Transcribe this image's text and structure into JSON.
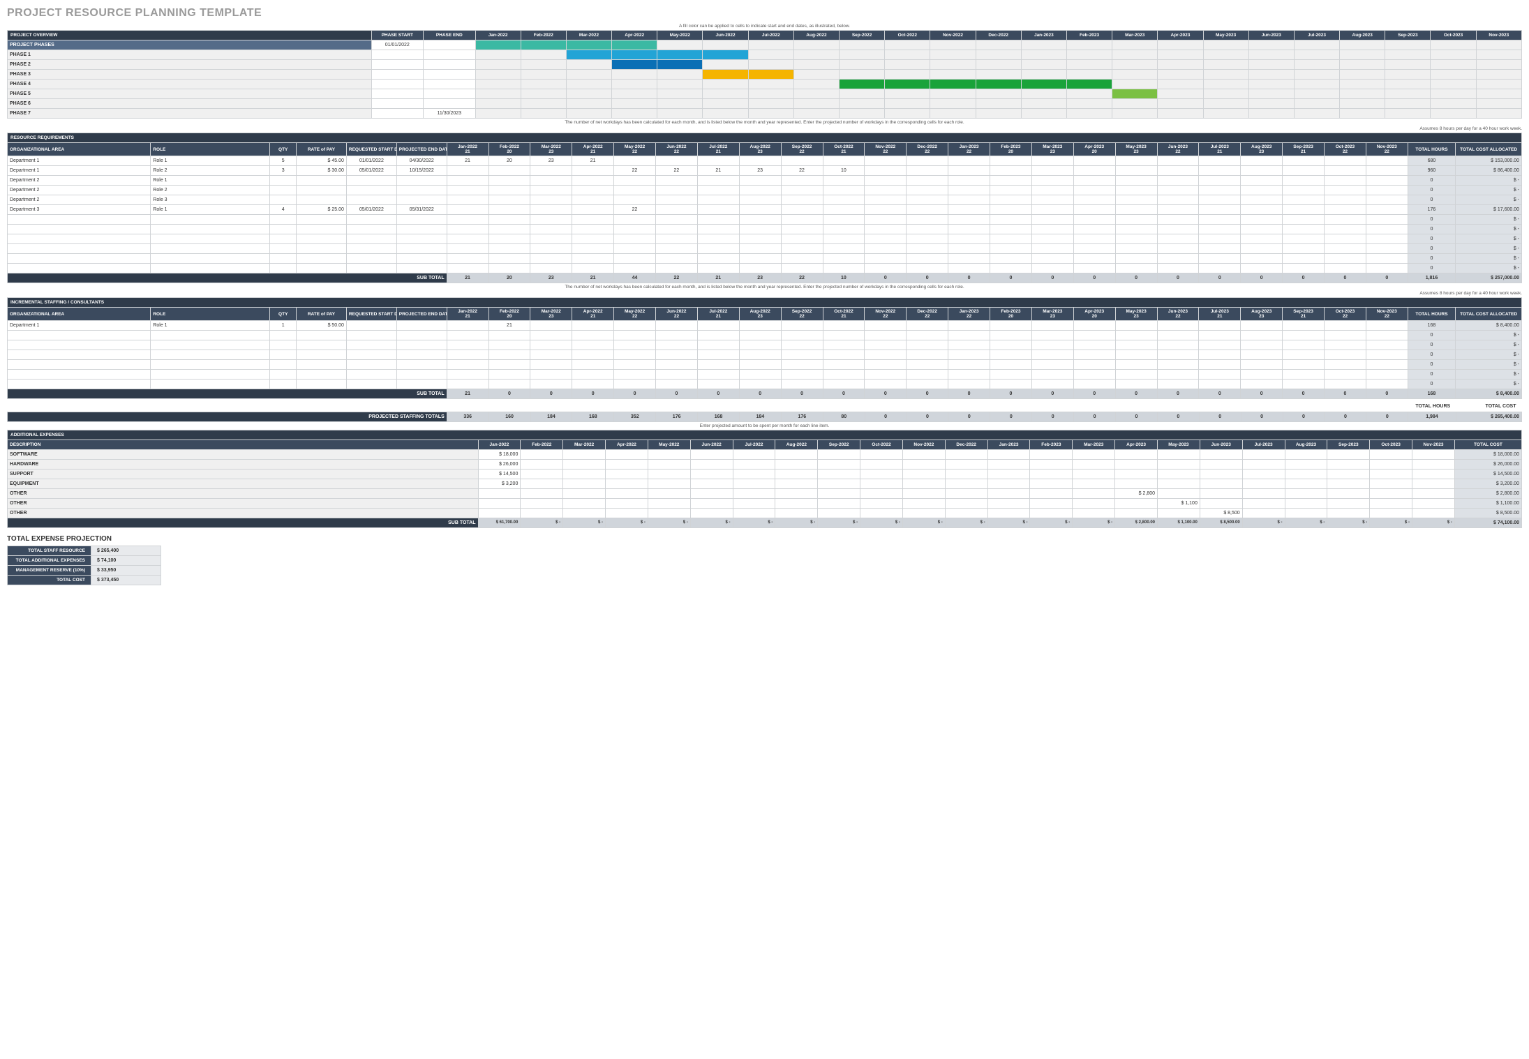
{
  "title": "PROJECT RESOURCE PLANNING TEMPLATE",
  "notes": {
    "gantt_hint": "A fill color can be applied to cells to indicate start and end dates, as illustrated, below.",
    "workdays_note": "The number of net workdays has been calculated for each month, and is listed below the month and year represented. Enter the projected number of workdays in the corresponding cells for each role.",
    "assumption": "Assumes 8 hours per day for a 40 hour work week.",
    "expense_hint": "Enter projected amount to be spent per month for each line item."
  },
  "months": [
    "Jan-2022",
    "Feb-2022",
    "Mar-2022",
    "Apr-2022",
    "May-2022",
    "Jun-2022",
    "Jul-2022",
    "Aug-2022",
    "Sep-2022",
    "Oct-2022",
    "Nov-2022",
    "Dec-2022",
    "Jan-2023",
    "Feb-2023",
    "Mar-2023",
    "Apr-2023",
    "May-2023",
    "Jun-2023",
    "Jul-2023",
    "Aug-2023",
    "Sep-2023",
    "Oct-2023",
    "Nov-2023"
  ],
  "workdays": [
    "21",
    "20",
    "23",
    "21",
    "22",
    "22",
    "21",
    "23",
    "22",
    "21",
    "22",
    "22",
    "22",
    "20",
    "23",
    "20",
    "23",
    "22",
    "21",
    "23",
    "21",
    "22",
    "22"
  ],
  "overview": {
    "header": "PROJECT OVERVIEW",
    "col_start": "PHASE START",
    "col_end": "PHASE END",
    "rows": [
      {
        "label": "PROJECT PHASES",
        "start": "01/01/2022",
        "end": "",
        "fill": [
          0,
          1,
          2,
          3
        ],
        "color": "#3bb9a3",
        "labelStyle": "mid"
      },
      {
        "label": "PHASE 1",
        "start": "",
        "end": "",
        "fill": [
          2,
          3,
          4,
          5
        ],
        "color": "#22a4d6",
        "labelStyle": "lbl"
      },
      {
        "label": "PHASE 2",
        "start": "",
        "end": "",
        "fill": [
          3,
          4
        ],
        "color": "#0a6fb5",
        "labelStyle": "lbl"
      },
      {
        "label": "PHASE 3",
        "start": "",
        "end": "",
        "fill": [
          5,
          6
        ],
        "color": "#f5b400",
        "labelStyle": "lbl"
      },
      {
        "label": "PHASE 4",
        "start": "",
        "end": "",
        "fill": [
          8,
          9,
          10,
          11,
          12,
          13
        ],
        "color": "#1aa33a",
        "labelStyle": "lbl"
      },
      {
        "label": "PHASE 5",
        "start": "",
        "end": "",
        "fill": [
          14
        ],
        "color": "#7bc043",
        "labelStyle": "lbl"
      },
      {
        "label": "PHASE 6",
        "start": "",
        "end": "",
        "fill": [],
        "color": "",
        "labelStyle": "lbl"
      },
      {
        "label": "PHASE 7",
        "start": "",
        "end": "11/30/2023",
        "fill": [],
        "color": "",
        "labelStyle": "lbl"
      }
    ]
  },
  "resource": {
    "header": "RESOURCE REQUIREMENTS",
    "cols": {
      "org": "ORGANIZATIONAL AREA",
      "role": "ROLE",
      "qty": "QTY",
      "rate": "RATE of PAY",
      "req": "REQUESTED START DATE",
      "end": "PROJECTED END DATE",
      "th": "TOTAL HOURS",
      "tc": "TOTAL COST ALLOCATED"
    },
    "rows": [
      {
        "org": "Department 1",
        "role": "Role 1",
        "qty": "5",
        "rate": "$   45.00",
        "req": "01/01/2022",
        "end": "04/30/2022",
        "cells": {
          "0": "21",
          "1": "20",
          "2": "23",
          "3": "21"
        },
        "th": "680",
        "tc": "$   153,000.00"
      },
      {
        "org": "Department 1",
        "role": "Role 2",
        "qty": "3",
        "rate": "$   30.00",
        "req": "05/01/2022",
        "end": "10/15/2022",
        "cells": {
          "4": "22",
          "5": "22",
          "6": "21",
          "7": "23",
          "8": "22",
          "9": "10"
        },
        "th": "960",
        "tc": "$    86,400.00"
      },
      {
        "org": "Department 2",
        "role": "Role 1",
        "qty": "",
        "rate": "",
        "req": "",
        "end": "",
        "cells": {},
        "th": "0",
        "tc": "$           -"
      },
      {
        "org": "Department 2",
        "role": "Role 2",
        "qty": "",
        "rate": "",
        "req": "",
        "end": "",
        "cells": {},
        "th": "0",
        "tc": "$           -"
      },
      {
        "org": "Department 2",
        "role": "Role 3",
        "qty": "",
        "rate": "",
        "req": "",
        "end": "",
        "cells": {},
        "th": "0",
        "tc": "$           -"
      },
      {
        "org": "Department 3",
        "role": "Role 1",
        "qty": "4",
        "rate": "$   25.00",
        "req": "05/01/2022",
        "end": "05/31/2022",
        "cells": {
          "4": "22"
        },
        "th": "176",
        "tc": "$    17,600.00"
      },
      {
        "org": "",
        "role": "",
        "qty": "",
        "rate": "",
        "req": "",
        "end": "",
        "cells": {},
        "th": "0",
        "tc": "$           -"
      },
      {
        "org": "",
        "role": "",
        "qty": "",
        "rate": "",
        "req": "",
        "end": "",
        "cells": {},
        "th": "0",
        "tc": "$           -"
      },
      {
        "org": "",
        "role": "",
        "qty": "",
        "rate": "",
        "req": "",
        "end": "",
        "cells": {},
        "th": "0",
        "tc": "$           -"
      },
      {
        "org": "",
        "role": "",
        "qty": "",
        "rate": "",
        "req": "",
        "end": "",
        "cells": {},
        "th": "0",
        "tc": "$           -"
      },
      {
        "org": "",
        "role": "",
        "qty": "",
        "rate": "",
        "req": "",
        "end": "",
        "cells": {},
        "th": "0",
        "tc": "$           -"
      },
      {
        "org": "",
        "role": "",
        "qty": "",
        "rate": "",
        "req": "",
        "end": "",
        "cells": {},
        "th": "0",
        "tc": "$           -"
      }
    ],
    "subtotal_label": "SUB TOTAL",
    "subtotals": [
      "21",
      "20",
      "23",
      "21",
      "44",
      "22",
      "21",
      "23",
      "22",
      "10",
      "0",
      "0",
      "0",
      "0",
      "0",
      "0",
      "0",
      "0",
      "0",
      "0",
      "0",
      "0",
      "0"
    ],
    "sub_th": "1,816",
    "sub_tc": "$   257,000.00"
  },
  "incremental": {
    "header": "INCREMENTAL STAFFING / CONSULTANTS",
    "rows": [
      {
        "org": "Department 1",
        "role": "Role 1",
        "qty": "1",
        "rate": "$   50.00",
        "req": "",
        "end": "",
        "cells": {
          "1": "21"
        },
        "th": "168",
        "tc": "$      8,400.00"
      },
      {
        "org": "",
        "role": "",
        "qty": "",
        "rate": "",
        "req": "",
        "end": "",
        "cells": {},
        "th": "0",
        "tc": "$           -"
      },
      {
        "org": "",
        "role": "",
        "qty": "",
        "rate": "",
        "req": "",
        "end": "",
        "cells": {},
        "th": "0",
        "tc": "$           -"
      },
      {
        "org": "",
        "role": "",
        "qty": "",
        "rate": "",
        "req": "",
        "end": "",
        "cells": {},
        "th": "0",
        "tc": "$           -"
      },
      {
        "org": "",
        "role": "",
        "qty": "",
        "rate": "",
        "req": "",
        "end": "",
        "cells": {},
        "th": "0",
        "tc": "$           -"
      },
      {
        "org": "",
        "role": "",
        "qty": "",
        "rate": "",
        "req": "",
        "end": "",
        "cells": {},
        "th": "0",
        "tc": "$           -"
      },
      {
        "org": "",
        "role": "",
        "qty": "",
        "rate": "",
        "req": "",
        "end": "",
        "cells": {},
        "th": "0",
        "tc": "$           -"
      }
    ],
    "subtotal_label": "SUB TOTAL",
    "subtotals": [
      "21",
      "0",
      "0",
      "0",
      "0",
      "0",
      "0",
      "0",
      "0",
      "0",
      "0",
      "0",
      "0",
      "0",
      "0",
      "0",
      "0",
      "0",
      "0",
      "0",
      "0",
      "0",
      "0"
    ],
    "sub_th": "168",
    "sub_tc": "$     8,400.00"
  },
  "projected_totals": {
    "header_hours": "TOTAL HOURS",
    "header_cost": "TOTAL COST",
    "label": "PROJECTED STAFFING TOTALS",
    "values": [
      "336",
      "160",
      "184",
      "168",
      "352",
      "176",
      "168",
      "184",
      "176",
      "80",
      "0",
      "0",
      "0",
      "0",
      "0",
      "0",
      "0",
      "0",
      "0",
      "0",
      "0",
      "0",
      "0"
    ],
    "th": "1,984",
    "tc": "$   265,400.00"
  },
  "expenses": {
    "header": "ADDITIONAL EXPENSES",
    "desc_col": "DESCRIPTION",
    "total_col": "TOTAL COST",
    "rows": [
      {
        "desc": "SOFTWARE",
        "cells": {
          "0": "$  18,000"
        },
        "total": "$    18,000.00"
      },
      {
        "desc": "HARDWARE",
        "cells": {
          "0": "$  26,000"
        },
        "total": "$    26,000.00"
      },
      {
        "desc": "SUPPORT",
        "cells": {
          "0": "$  14,500"
        },
        "total": "$    14,500.00"
      },
      {
        "desc": "EQUIPMENT",
        "cells": {
          "0": "$    3,200"
        },
        "total": "$     3,200.00"
      },
      {
        "desc": "OTHER",
        "cells": {
          "15": "$   2,800"
        },
        "total": "$     2,800.00"
      },
      {
        "desc": "OTHER",
        "cells": {
          "16": "$   1,100"
        },
        "total": "$     1,100.00"
      },
      {
        "desc": "OTHER",
        "cells": {
          "17": "$   8,500"
        },
        "total": "$     8,500.00"
      }
    ],
    "subtotal_label": "SUB TOTAL",
    "subtotals": [
      "$ 61,700.00",
      "$      -",
      "$      -",
      "$      -",
      "$      -",
      "$      -",
      "$      -",
      "$      -",
      "$      -",
      "$      -",
      "$      -",
      "$      -",
      "$      -",
      "$      -",
      "$      -",
      "$ 2,800.00",
      "$ 1,100.00",
      "$ 8,500.00",
      "$      -",
      "$      -",
      "$      -",
      "$      -",
      "$      -"
    ],
    "sub_total": "$    74,100.00"
  },
  "summary": {
    "header": "TOTAL EXPENSE PROJECTION",
    "rows": [
      {
        "label": "TOTAL STAFF RESOURCE",
        "val": "$                      265,400"
      },
      {
        "label": "TOTAL ADDITIONAL EXPENSES",
        "val": "$                        74,100"
      },
      {
        "label": "MANAGEMENT RESERVE (10%)",
        "val": "$                        33,950"
      },
      {
        "label": "TOTAL COST",
        "val": "$                      373,450"
      }
    ]
  }
}
